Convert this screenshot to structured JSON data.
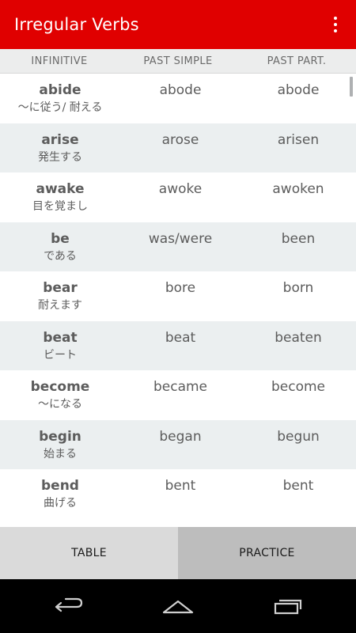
{
  "app": {
    "title": "Irregular Verbs"
  },
  "table": {
    "headers": [
      "INFINITIVE",
      "PAST SIMPLE",
      "PAST PART."
    ],
    "rows": [
      {
        "infinitive": "abide",
        "meaning": "〜に従う/ 耐える",
        "past_simple": "abode",
        "past_participle": "abode"
      },
      {
        "infinitive": "arise",
        "meaning": "発生する",
        "past_simple": "arose",
        "past_participle": "arisen"
      },
      {
        "infinitive": "awake",
        "meaning": "目を覚まし",
        "past_simple": "awoke",
        "past_participle": "awoken"
      },
      {
        "infinitive": "be",
        "meaning": "である",
        "past_simple": "was/were",
        "past_participle": "been"
      },
      {
        "infinitive": "bear",
        "meaning": "耐えます",
        "past_simple": "bore",
        "past_participle": "born"
      },
      {
        "infinitive": "beat",
        "meaning": "ビート",
        "past_simple": "beat",
        "past_participle": "beaten"
      },
      {
        "infinitive": "become",
        "meaning": "〜になる",
        "past_simple": "became",
        "past_participle": "become"
      },
      {
        "infinitive": "begin",
        "meaning": "始まる",
        "past_simple": "began",
        "past_participle": "begun"
      },
      {
        "infinitive": "bend",
        "meaning": "曲げる",
        "past_simple": "bent",
        "past_participle": "bent"
      }
    ]
  },
  "tabs": [
    {
      "label": "TABLE",
      "selected": true
    },
    {
      "label": "PRACTICE",
      "selected": false
    }
  ],
  "icons": {
    "overflow": "more-vertical-icon",
    "back": "back-icon",
    "home": "home-icon",
    "recents": "recent-apps-icon"
  },
  "colors": {
    "appbar": "#e00000",
    "row_alt": "#ebeff0",
    "tab_table": "#dadada",
    "tab_practice": "#bdbdbd"
  }
}
